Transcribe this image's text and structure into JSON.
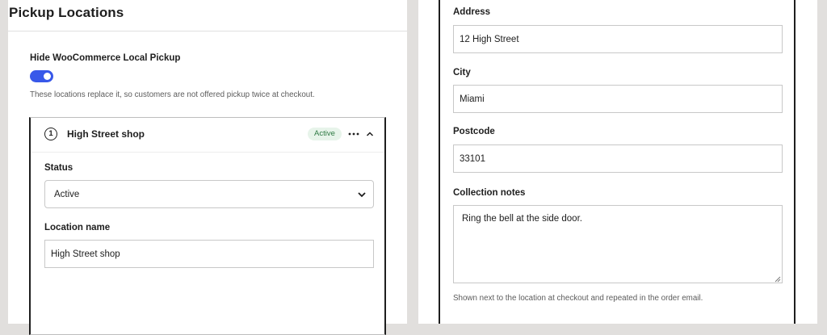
{
  "left_panel": {
    "title": "Pickup Locations",
    "toggle": {
      "label": "Hide WooCommerce Local Pickup",
      "enabled": true,
      "help": "These locations replace it, so customers are not offered pickup twice at checkout."
    },
    "location_card": {
      "index": "1",
      "name": "High Street shop",
      "badge": "Active",
      "status_label": "Status",
      "status_value": "Active",
      "location_name_label": "Location name",
      "location_name_value": "High Street shop"
    }
  },
  "right_panel": {
    "address_label": "Address",
    "address_value": "12 High Street",
    "city_label": "City",
    "city_value": "Miami",
    "postcode_label": "Postcode",
    "postcode_value": "33101",
    "notes_label": "Collection notes",
    "notes_value": "Ring the bell at the side door.",
    "notes_help": "Shown next to the location at checkout and repeated in the order email."
  },
  "colors": {
    "background": "#e1dfdd",
    "toggle_on": "#3858e9",
    "badge_bg": "#e7f4ea",
    "badge_text": "#2f7a44"
  },
  "icons": [
    "more-horizontal-icon",
    "chevron-up-icon",
    "chevron-down-icon",
    "resize-grip-icon"
  ]
}
